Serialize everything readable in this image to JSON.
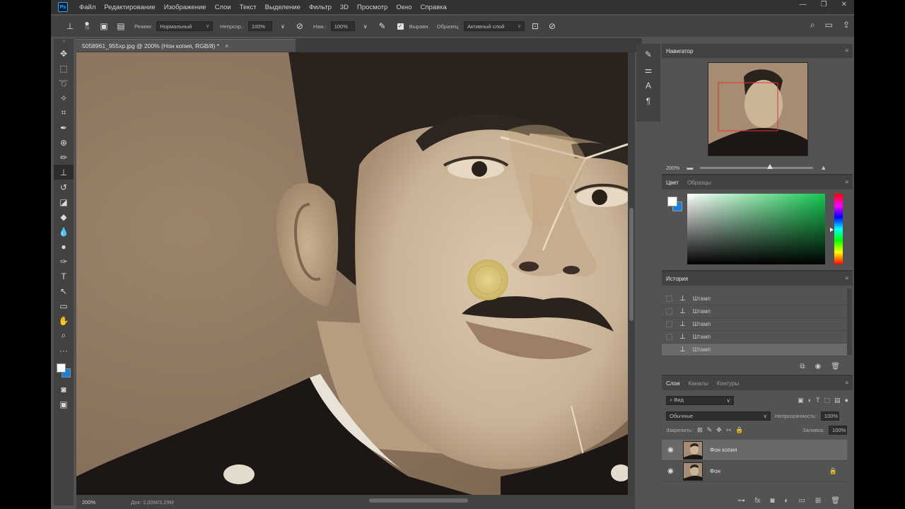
{
  "menu": {
    "logo": "Ps",
    "items": [
      "Файл",
      "Редактирование",
      "Изображение",
      "Слои",
      "Текст",
      "Выделение",
      "Фильтр",
      "3D",
      "Просмотр",
      "Окно",
      "Справка"
    ],
    "window_controls": [
      "—",
      "❐",
      "✕"
    ]
  },
  "options": {
    "brush_size": "70",
    "mode_label": "Режим:",
    "mode_value": "Нормальный",
    "opacity_label": "Непрозр.:",
    "opacity_value": "100%",
    "flow_label": "Наж.:",
    "flow_value": "100%",
    "aligned_label": "Выравн.",
    "sample_label": "Образец:",
    "sample_value": "Активный слой"
  },
  "document": {
    "tab_title": "5058961_955xp.jpg @ 200% (Нон копия, RGB/8) *",
    "close_symbol": "×"
  },
  "status": {
    "zoom": "200%",
    "doc_info": "Док: 1,00M/3,29M"
  },
  "navigator": {
    "title": "Навигатор",
    "zoom": "200%"
  },
  "color_panel": {
    "tabs": [
      "Цвет",
      "Образцы"
    ],
    "foreground": "#ffffff",
    "background": "#1c7fd6",
    "hue": "#14c850"
  },
  "history": {
    "title": "История",
    "items": [
      {
        "label": "Штамп"
      },
      {
        "label": "Штамп"
      },
      {
        "label": "Штамп"
      },
      {
        "label": "Штамп"
      },
      {
        "label": "Штамп"
      }
    ]
  },
  "layers": {
    "tabs": [
      "Слои",
      "Каналы",
      "Контуры"
    ],
    "filter_value": "Вид",
    "blend_value": "Обычные",
    "opacity_label": "Непрозрачность:",
    "opacity_value": "100%",
    "lock_label": "Закрепить:",
    "fill_label": "Заливка:",
    "fill_value": "100%",
    "items": [
      {
        "name": "Фон копия",
        "active": true
      },
      {
        "name": "Фон",
        "active": false
      }
    ]
  },
  "icons": {
    "menu_icon": "≡",
    "eye_icon": "👁",
    "lock_icon": "🔒"
  }
}
